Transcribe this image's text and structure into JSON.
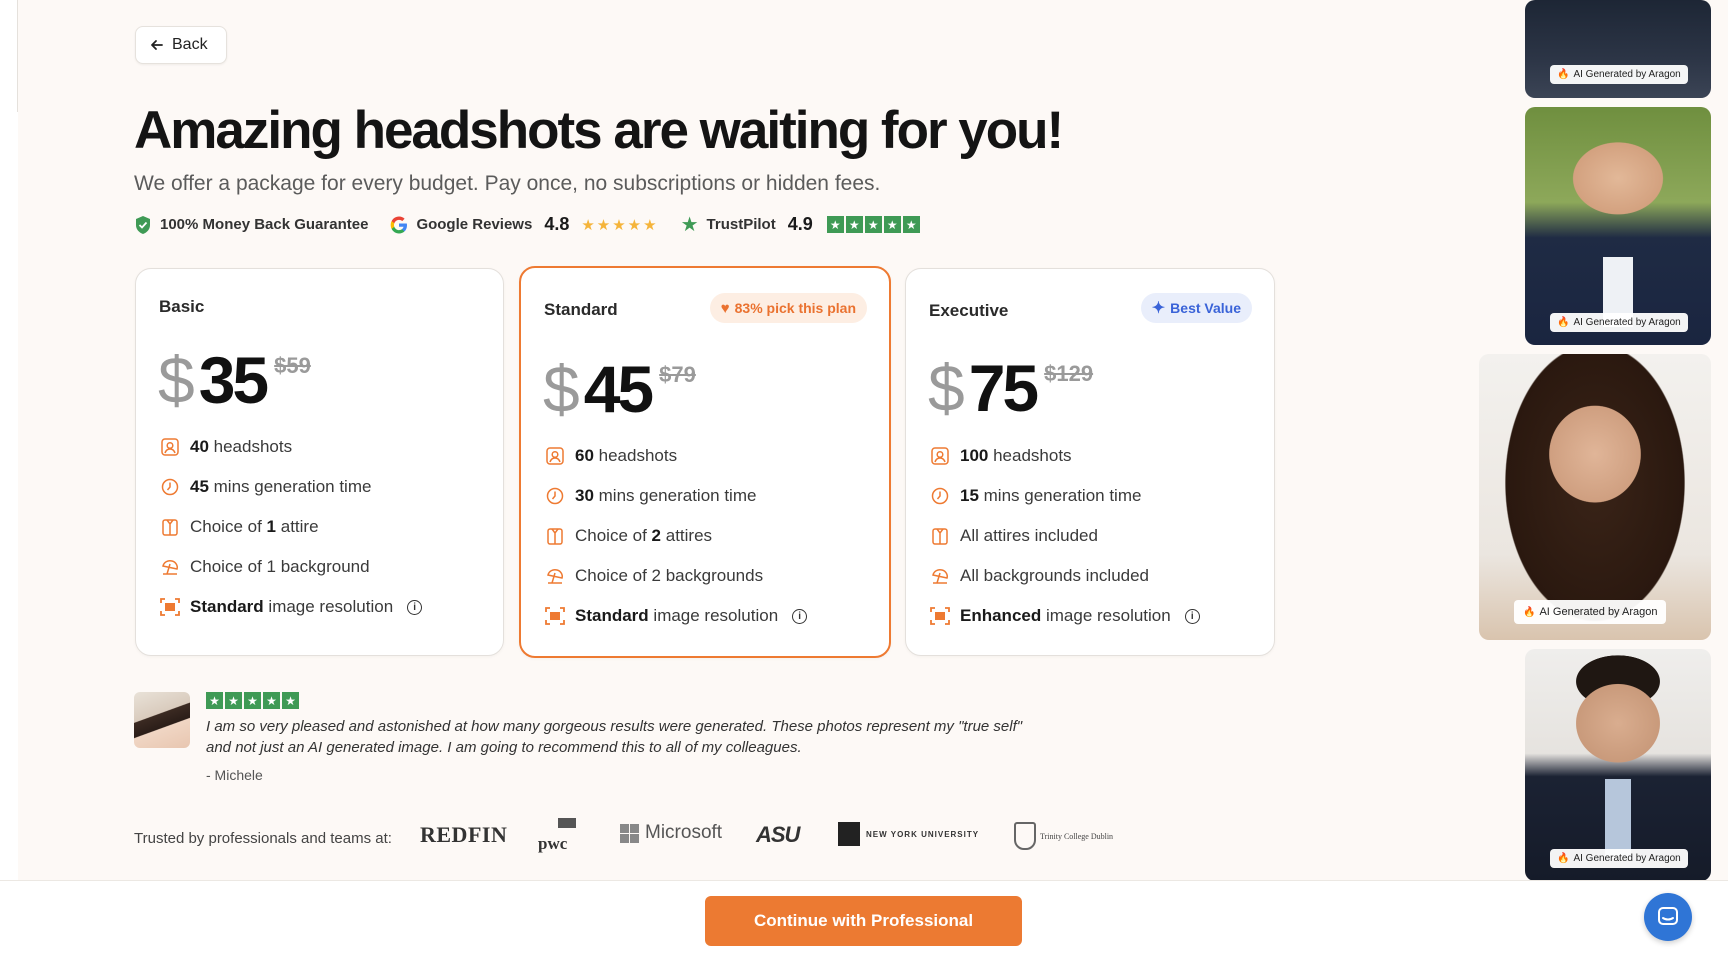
{
  "nav": {
    "back_label": "Back"
  },
  "hero": {
    "headline": "Amazing headshots are waiting for you!",
    "subline": "We offer a package for every budget. Pay once, no subscriptions or hidden fees."
  },
  "trust": {
    "guarantee": "100% Money Back Guarantee",
    "google_label": "Google Reviews",
    "google_rating": "4.8",
    "google_stars": "★★★★★",
    "trustpilot_label": "TrustPilot",
    "trustpilot_rating": "4.9"
  },
  "plans": [
    {
      "name": "Basic",
      "currency": "$",
      "price": "35",
      "old_price": "$59",
      "badge": "",
      "features": [
        {
          "bold": "40",
          "text": " headshots"
        },
        {
          "bold": "45",
          "text": " mins generation time"
        },
        {
          "pre": "Choice of ",
          "bold": "1",
          "text": " attire"
        },
        {
          "pre": "Choice of 1 background",
          "bold": "",
          "text": ""
        },
        {
          "bold": "Standard",
          "text": " image resolution"
        }
      ]
    },
    {
      "name": "Standard",
      "currency": "$",
      "price": "45",
      "old_price": "$79",
      "badge": "83% pick this plan",
      "features": [
        {
          "bold": "60",
          "text": " headshots"
        },
        {
          "bold": "30",
          "text": " mins generation time"
        },
        {
          "pre": "Choice of ",
          "bold": "2",
          "text": " attires"
        },
        {
          "pre": "Choice of 2 backgrounds",
          "bold": "",
          "text": ""
        },
        {
          "bold": "Standard",
          "text": " image resolution"
        }
      ]
    },
    {
      "name": "Executive",
      "currency": "$",
      "price": "75",
      "old_price": "$129",
      "badge": "Best Value",
      "features": [
        {
          "bold": "100",
          "text": " headshots"
        },
        {
          "bold": "15",
          "text": " mins generation time"
        },
        {
          "pre": "All attires included",
          "bold": "",
          "text": ""
        },
        {
          "pre": "All backgrounds included",
          "bold": "",
          "text": ""
        },
        {
          "bold": "Enhanced",
          "text": " image resolution"
        }
      ]
    }
  ],
  "review": {
    "text": "I am so very pleased and astonished at how many gorgeous results were generated. These photos represent my \"true self\" and not just an AI generated image. I am going to recommend this to all of my colleagues.",
    "author": "- Michele"
  },
  "trusted": {
    "label": "Trusted by professionals and teams at:",
    "logos": [
      "REDFIN",
      "pwc",
      "Microsoft",
      "ASU",
      "NEW YORK UNIVERSITY",
      "Trinity College Dublin"
    ]
  },
  "photos": {
    "tag": "AI Generated by Aragon"
  },
  "cta": {
    "label": "Continue with Professional"
  },
  "colors": {
    "accent": "#ec7a32",
    "trustpilot_green": "#3f9a55",
    "best_value_blue": "#3a63d8"
  }
}
